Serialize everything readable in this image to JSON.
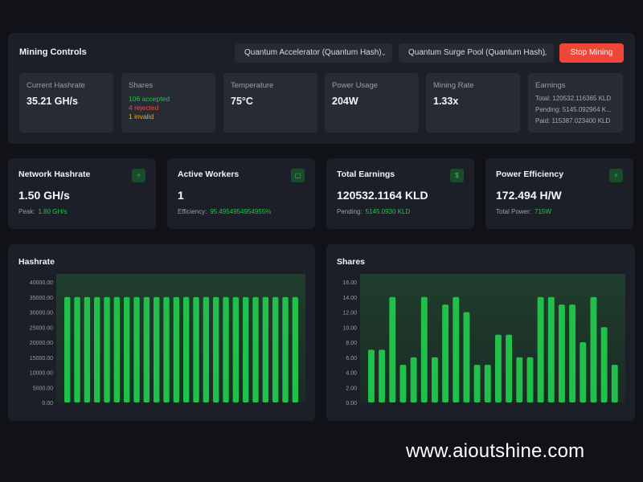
{
  "controls": {
    "title": "Mining Controls",
    "device_select": "Quantum Accelerator (Quantum Hash)",
    "pool_select": "Quantum Surge Pool (Quantum Hash)",
    "stop_label": "Stop Mining",
    "stats": {
      "hashrate": {
        "label": "Current Hashrate",
        "value": "35.21 GH/s"
      },
      "shares": {
        "label": "Shares",
        "accepted": "106 accepted",
        "rejected": "4 rejected",
        "invalid": "1 invalid"
      },
      "temperature": {
        "label": "Temperature",
        "value": "75°C"
      },
      "power": {
        "label": "Power Usage",
        "value": "204W"
      },
      "rate": {
        "label": "Mining Rate",
        "value": "1.33x"
      },
      "earnings": {
        "label": "Earnings",
        "total": "Total: 120532.116365 KLD",
        "pending": "Pending: 5145.092964 K...",
        "paid": "Paid: 115387.023400 KLD"
      }
    }
  },
  "cards": {
    "network": {
      "title": "Network Hashrate",
      "value": "1.50 GH/s",
      "sub_label": "Peak:",
      "sub_value": "1.80 GH/s",
      "icon": "activity-icon"
    },
    "workers": {
      "title": "Active Workers",
      "value": "1",
      "sub_label": "Efficiency:",
      "sub_value": "95.4954954954955%",
      "icon": "cpu-icon"
    },
    "earnings": {
      "title": "Total Earnings",
      "value": "120532.1164 KLD",
      "sub_label": "Pending:",
      "sub_value": "5145.0930 KLD",
      "icon": "dollar-icon"
    },
    "efficiency": {
      "title": "Power Efficiency",
      "value": "172.494 H/W",
      "sub_label": "Total Power:",
      "sub_value": "715W",
      "icon": "zap-icon"
    }
  },
  "colors": {
    "accent": "#27c24c",
    "danger": "#ef4637",
    "warning": "#e8b320",
    "bar": "#21c04a"
  },
  "chart_data": [
    {
      "type": "bar",
      "title": "Hashrate",
      "ylim": [
        0,
        40000
      ],
      "yticks": [
        "40000.00",
        "35000.00",
        "30000.00",
        "25000.00",
        "20000.00",
        "15000.00",
        "10000.00",
        "5000.00",
        "0.00"
      ],
      "values": [
        35000,
        35000,
        35000,
        35000,
        35000,
        35000,
        35000,
        35000,
        35000,
        35000,
        35000,
        35000,
        35000,
        35000,
        35000,
        35000,
        35000,
        35000,
        35000,
        35000,
        35000,
        35000,
        35000,
        35000
      ]
    },
    {
      "type": "bar",
      "title": "Shares",
      "ylim": [
        0,
        16
      ],
      "yticks": [
        "16.00",
        "14.00",
        "12.00",
        "10.00",
        "8.00",
        "6.00",
        "4.00",
        "2.00",
        "0.00"
      ],
      "values": [
        7,
        7,
        14,
        5,
        6,
        14,
        6,
        13,
        14,
        12,
        5,
        5,
        9,
        9,
        6,
        6,
        14,
        14,
        13,
        13,
        8,
        14,
        10,
        5
      ]
    }
  ],
  "watermark": "www.aioutshine.com"
}
